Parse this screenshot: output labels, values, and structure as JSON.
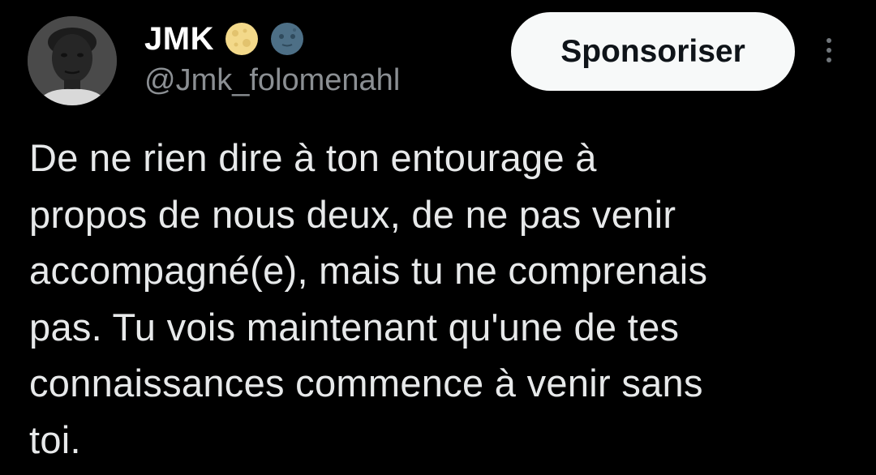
{
  "author": {
    "display_name": "JMK",
    "handle": "@Jmk_folomenahl",
    "avatar": "profile-photo",
    "badges": [
      "full-moon-emoji",
      "new-moon-face-emoji"
    ]
  },
  "actions": {
    "sponsor_label": "Sponsoriser",
    "more_icon": "vertical-ellipsis-icon"
  },
  "tweet": {
    "text": "De ne rien dire à ton entourage à\npropos de nous deux, de ne pas venir\naccompagné(e), mais tu ne comprenais\npas. Tu vois maintenant qu'une de tes\nconnaissances commence à venir sans\ntoi."
  },
  "colors": {
    "background": "#000000",
    "primary_text": "#e7e9ea",
    "secondary_text": "#8b8f93",
    "button_bg": "#f7f9f9",
    "button_text": "#0f1419"
  }
}
